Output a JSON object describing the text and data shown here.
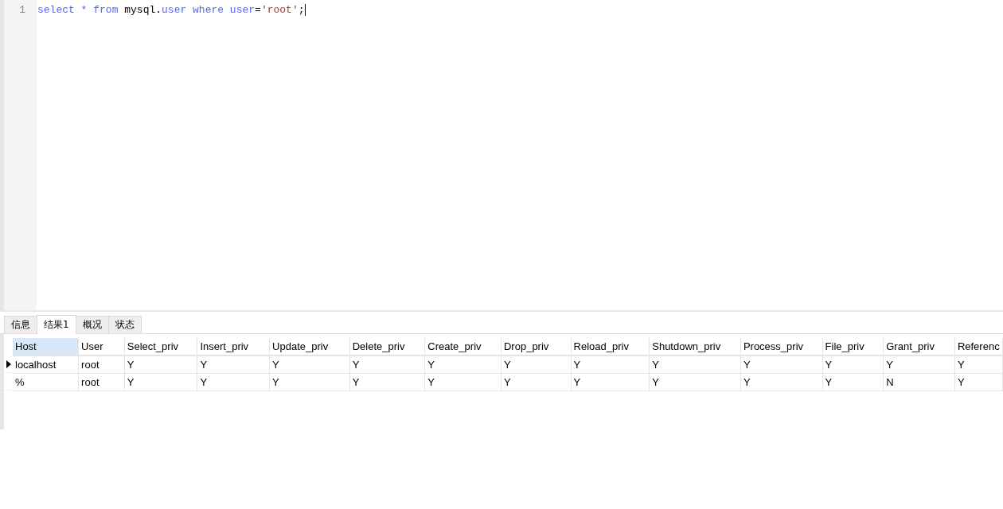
{
  "editor": {
    "lines": [
      {
        "number": "1",
        "tokens": [
          {
            "text": "select *",
            "kind": "keyword"
          },
          {
            "text": " from",
            "kind": "keyword"
          },
          {
            "text": " mysql.",
            "kind": "plain"
          },
          {
            "text": "user where user",
            "kind": "keyword"
          },
          {
            "text": "=",
            "kind": "plain"
          },
          {
            "text": "'root'",
            "kind": "string"
          },
          {
            "text": ";",
            "kind": "plain"
          }
        ]
      }
    ]
  },
  "tabs": [
    {
      "label": "信息",
      "selected": false
    },
    {
      "label": "结果1",
      "selected": true
    },
    {
      "label": "概况",
      "selected": false
    },
    {
      "label": "状态",
      "selected": false
    }
  ],
  "table": {
    "columns": [
      {
        "label": "Host",
        "selected": true
      },
      {
        "label": "User",
        "selected": false
      },
      {
        "label": "Select_priv",
        "selected": false
      },
      {
        "label": "Insert_priv",
        "selected": false
      },
      {
        "label": "Update_priv",
        "selected": false
      },
      {
        "label": "Delete_priv",
        "selected": false
      },
      {
        "label": "Create_priv",
        "selected": false
      },
      {
        "label": "Drop_priv",
        "selected": false
      },
      {
        "label": "Reload_priv",
        "selected": false
      },
      {
        "label": "Shutdown_priv",
        "selected": false
      },
      {
        "label": "Process_priv",
        "selected": false
      },
      {
        "label": "File_priv",
        "selected": false
      },
      {
        "label": "Grant_priv",
        "selected": false
      },
      {
        "label": "Referenc",
        "selected": false
      }
    ],
    "rows": [
      {
        "selected": true,
        "cells": [
          "localhost",
          "root",
          "Y",
          "Y",
          "Y",
          "Y",
          "Y",
          "Y",
          "Y",
          "Y",
          "Y",
          "Y",
          "Y",
          "Y"
        ]
      },
      {
        "selected": false,
        "cells": [
          "%",
          "root",
          "Y",
          "Y",
          "Y",
          "Y",
          "Y",
          "Y",
          "Y",
          "Y",
          "Y",
          "Y",
          "N",
          "Y"
        ]
      }
    ]
  }
}
